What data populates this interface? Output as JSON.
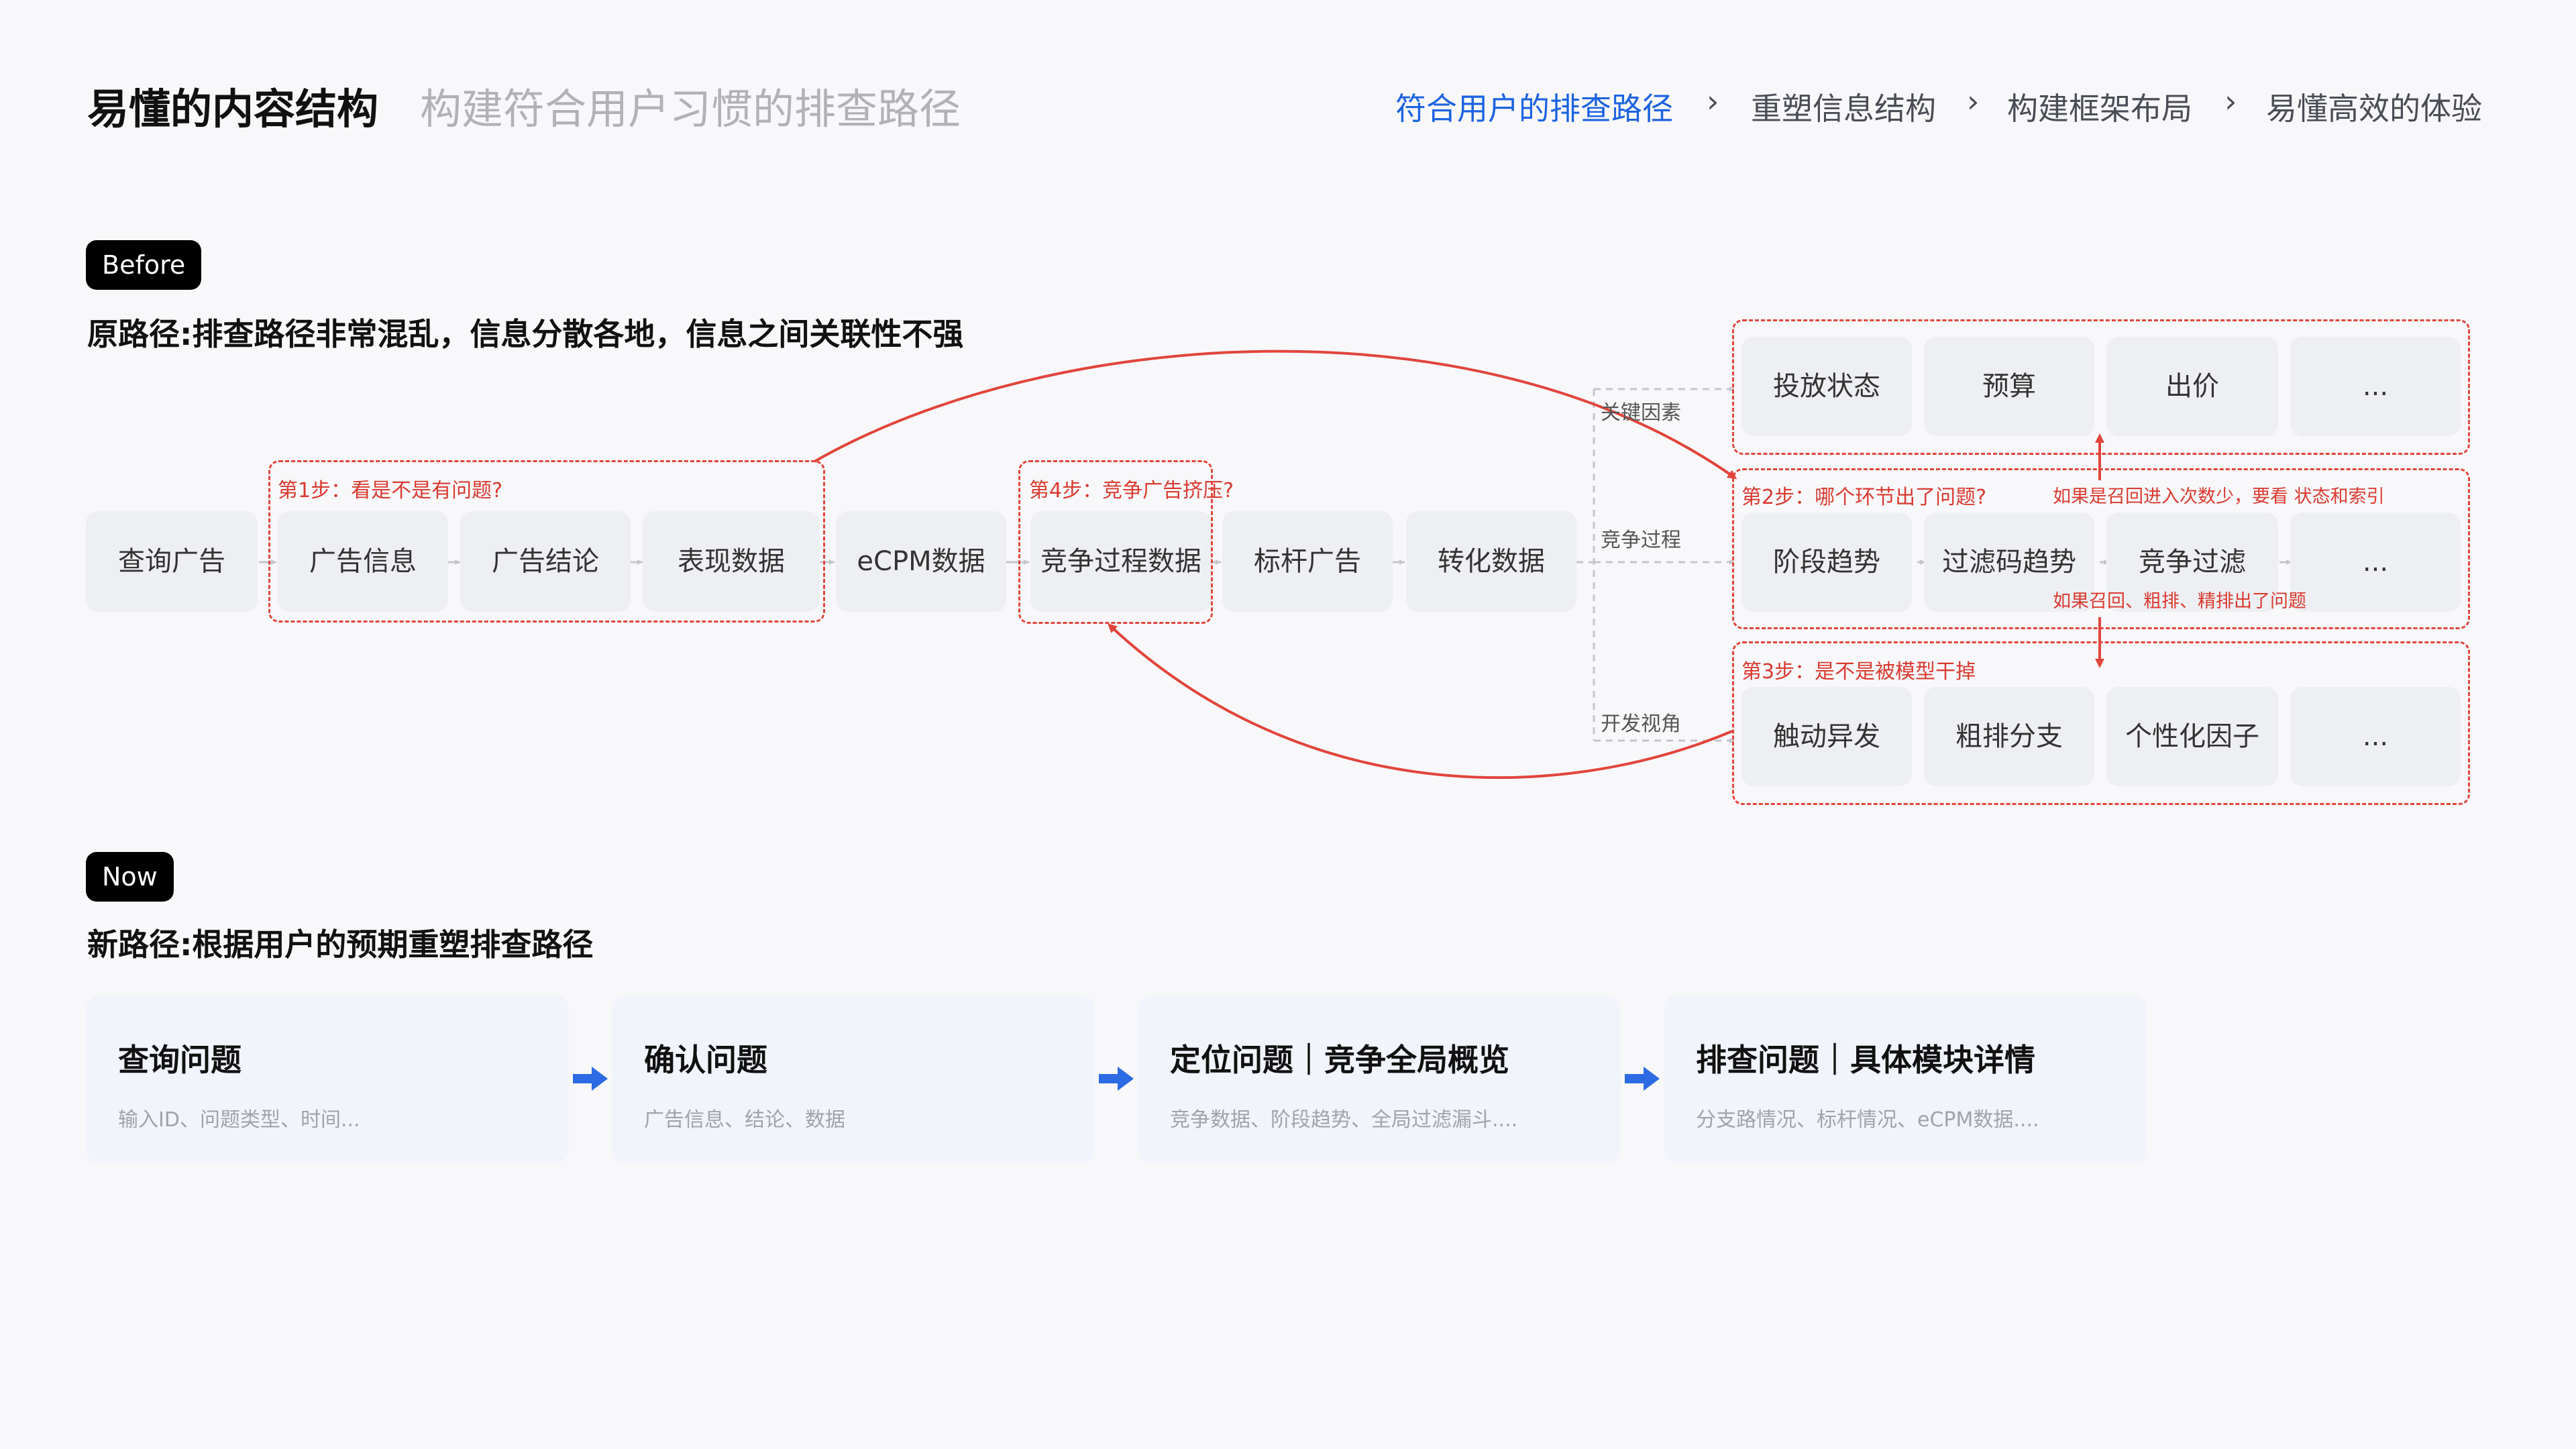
{
  "header": {
    "title": "易懂的内容结构",
    "subtitle": "构建符合用户习惯的排查路径",
    "breadcrumb": [
      "符合用户的排查路径",
      "重塑信息结构",
      "构建框架布局",
      "易懂高效的体验"
    ],
    "breadcrumb_separator": "›"
  },
  "before": {
    "tag": "Before",
    "title": "原路径:排查路径非常混乱，信息分散各地，信息之间关联性不强",
    "nodes": [
      "查询广告",
      "广告信息",
      "广告结论",
      "表现数据",
      "eCPM数据",
      "竞争过程数据",
      "标杆广告",
      "转化数据"
    ],
    "step1": "第1步：看是不是有问题?",
    "step4": "第4步：竞争广告挤压?",
    "branches": {
      "key_factors": "关键因素",
      "competition": "竞争过程",
      "dev_view": "开发视角"
    },
    "row1": [
      "投放状态",
      "预算",
      "出价",
      "..."
    ],
    "step2": "第2步：哪个环节出了问题?",
    "note1": "如果是召回进入次数少，要看 状态和索引",
    "row2": [
      "阶段趋势",
      "过滤码趋势",
      "竞争过滤",
      "..."
    ],
    "note2": "如果召回、粗排、精排出了问题",
    "step3": "第3步：是不是被模型干掉",
    "row3": [
      "触动异发",
      "粗排分支",
      "个性化因子",
      "..."
    ]
  },
  "now": {
    "tag": "Now",
    "title": "新路径:根据用户的预期重塑排查路径",
    "cards": [
      {
        "title": "查询问题",
        "desc": "输入ID、问题类型、时间..."
      },
      {
        "title": "确认问题",
        "desc": "广告信息、结论、数据"
      },
      {
        "title": "定位问题｜竞争全局概览",
        "desc": "竞争数据、阶段趋势、全局过滤漏斗...."
      },
      {
        "title": "排查问题｜具体模块详情",
        "desc": "分支路情况、标杆情况、eCPM数据...."
      }
    ]
  },
  "colors": {
    "accent_blue": "#1d63e0",
    "alert_red": "#e1453c",
    "node_bg": "#eeeff2",
    "card_bg": "#f1f4fb"
  }
}
